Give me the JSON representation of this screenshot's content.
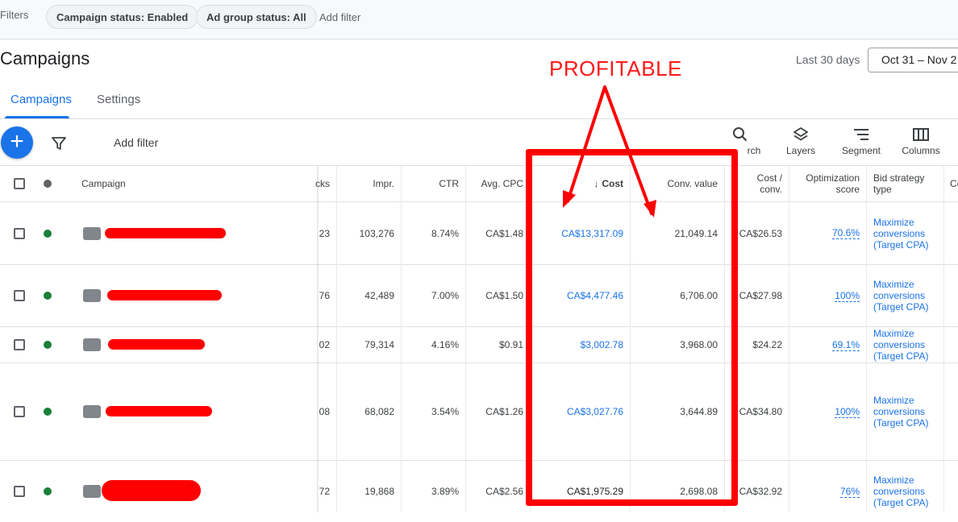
{
  "filters": {
    "label": "Filters",
    "chips": [
      "Campaign status: Enabled",
      "Ad group status: All"
    ],
    "add_filter": "Add filter"
  },
  "header": {
    "title": "Campaigns",
    "date_label": "Last 30 days",
    "date_range": "Oct 31 – Nov 2"
  },
  "tabs": [
    "Campaigns",
    "Settings"
  ],
  "toolbar": {
    "add_filter": "Add filter",
    "tools": [
      {
        "label": "rch",
        "icon": "search-icon"
      },
      {
        "label": "Layers",
        "icon": "layers-icon"
      },
      {
        "label": "Segment",
        "icon": "segment-icon"
      },
      {
        "label": "Columns",
        "icon": "columns-icon"
      }
    ]
  },
  "table": {
    "headers": {
      "campaign": "Campaign",
      "clicks": "cks",
      "impr": "Impr.",
      "ctr": "CTR",
      "avg_cpc": "Avg. CPC",
      "cost": "Cost",
      "conv_value": "Conv. value",
      "cost_conv_1": "Cost /",
      "cost_conv_2": "conv.",
      "opt_1": "Optimization",
      "opt_2": "score",
      "bid_1": "Bid strategy",
      "bid_2": "type",
      "next": "Co"
    },
    "rows": [
      {
        "clicks": "23",
        "impr": "103,276",
        "ctr": "8.74%",
        "cpc": "CA$1.48",
        "cost": "CA$13,317.09",
        "conv_value": "21,049.14",
        "cost_conv": "CA$26.53",
        "opt": "70.6%",
        "bid": [
          "Maximize",
          "conversions",
          "(Target CPA)"
        ]
      },
      {
        "clicks": "76",
        "impr": "42,489",
        "ctr": "7.00%",
        "cpc": "CA$1.50",
        "cost": "CA$4,477.46",
        "conv_value": "6,706.00",
        "cost_conv": "CA$27.98",
        "opt": "100%",
        "bid": [
          "Maximize",
          "conversions",
          "(Target CPA)"
        ]
      },
      {
        "clicks": "02",
        "impr": "79,314",
        "ctr": "4.16%",
        "cpc": "$0.91",
        "cost": "$3,002.78",
        "conv_value": "3,968.00",
        "cost_conv": "$24.22",
        "opt": "69.1%",
        "bid": [
          "Maximize",
          "conversions",
          "(Target CPA)"
        ]
      },
      {
        "clicks": "08",
        "impr": "68,082",
        "ctr": "3.54%",
        "cpc": "CA$1.26",
        "cost": "CA$3,027.76",
        "conv_value": "3,644.89",
        "cost_conv": "CA$34.80",
        "opt": "100%",
        "bid": [
          "Maximize",
          "conversions",
          "(Target CPA)"
        ]
      },
      {
        "clicks": "72",
        "impr": "19,868",
        "ctr": "3.89%",
        "cpc": "CA$2.56",
        "cost": "CA$1,975.29",
        "conv_value": "2,698.08",
        "cost_conv": "CA$32.92",
        "opt": "76%",
        "bid": [
          "Maximize",
          "conversions",
          "(Target CPA)"
        ]
      }
    ]
  },
  "annotation": {
    "label": "PROFITABLE",
    "color": "#ff0000"
  },
  "colors": {
    "accent": "#1a73e8",
    "enabled": "#188038",
    "annotation": "#ff0000"
  }
}
